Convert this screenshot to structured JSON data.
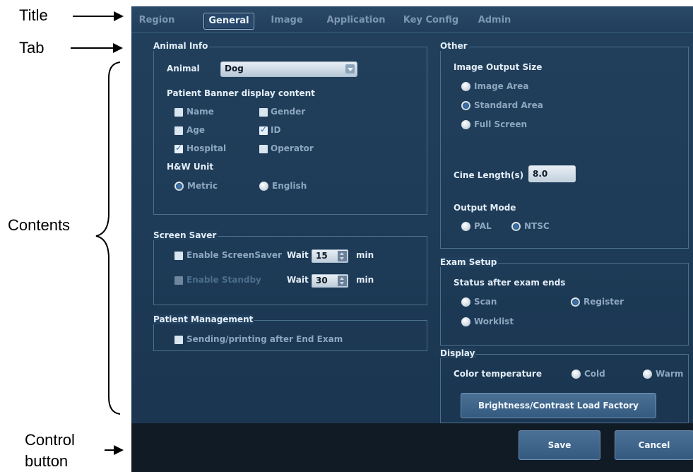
{
  "annotations": {
    "title": "Title",
    "tab": "Tab",
    "contents": "Contents",
    "control_button_line1": "Control",
    "control_button_line2": "button"
  },
  "tabs": [
    "Region",
    "General",
    "Image",
    "Application",
    "Key Config",
    "Admin"
  ],
  "active_tab": "General",
  "animal_info": {
    "legend": "Animal Info",
    "animal_label": "Animal",
    "animal_value": "Dog",
    "banner_heading": "Patient Banner display content",
    "name": "Name",
    "gender": "Gender",
    "age": "Age",
    "id": "ID",
    "hospital": "Hospital",
    "operator": "Operator",
    "hw_unit_heading": "H&W Unit",
    "metric": "Metric",
    "english": "English"
  },
  "screen_saver": {
    "legend": "Screen Saver",
    "enable_label": "Enable ScreenSaver",
    "disabled_label": "Enable Standby",
    "wait_label": "Wait",
    "wait1_value": "15",
    "wait2_value": "30",
    "min_label": "min"
  },
  "patient_management": {
    "legend": "Patient Management",
    "sending_label": "Sending/printing after End Exam"
  },
  "other": {
    "legend": "Other",
    "image_output_heading": "Image Output Size",
    "image_area": "Image Area",
    "standard_area": "Standard Area",
    "full_screen": "Full Screen",
    "cine_label": "Cine Length(s)",
    "cine_value": "8.0",
    "output_mode_heading": "Output Mode",
    "pal": "PAL",
    "ntsc": "NTSC"
  },
  "exam_setup": {
    "legend": "Exam Setup",
    "status_heading": "Status after exam ends",
    "scan": "Scan",
    "register": "Register",
    "worklist": "Worklist"
  },
  "display": {
    "legend": "Display",
    "color_temp_label": "Color temperature",
    "cold": "Cold",
    "warm": "Warm",
    "load_factory_button": "Brightness/Contrast Load Factory"
  },
  "buttons": {
    "save": "Save",
    "cancel": "Cancel"
  },
  "colors": {
    "background": "#1d3a56",
    "bottom_bar": "#111b26",
    "button": "#3f6489"
  }
}
